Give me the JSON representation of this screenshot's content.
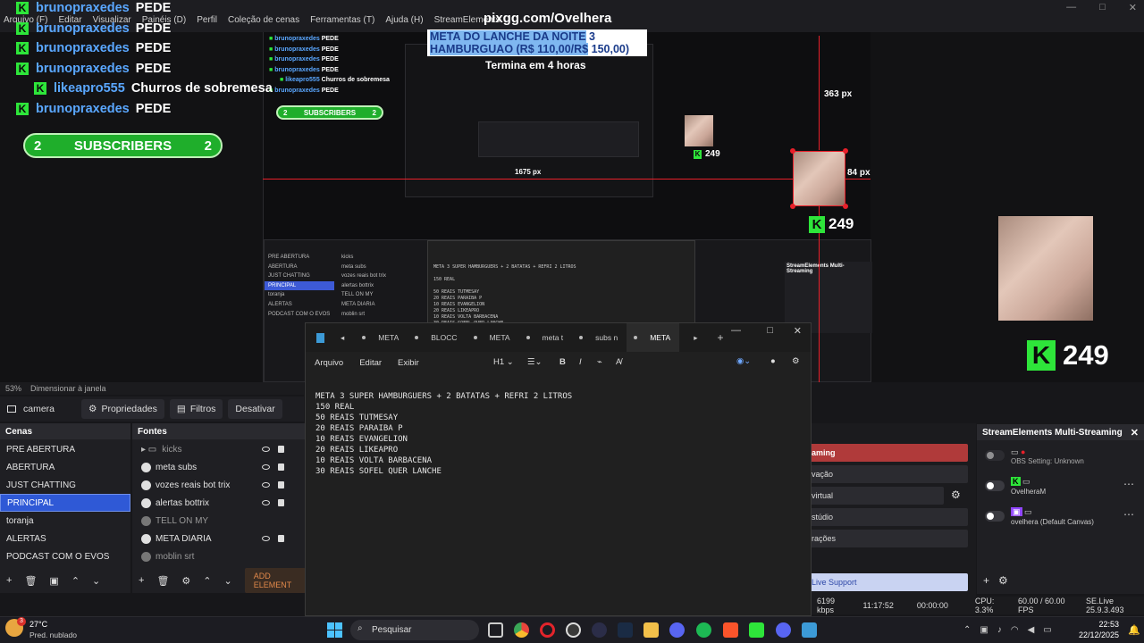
{
  "menubar": [
    "Arquivo (F)",
    "Editar",
    "Visualizar",
    "Painéis (D)",
    "Perfil",
    "Coleção de cenas",
    "Ferramentas (T)",
    "Ajuda (H)",
    "StreamElements"
  ],
  "overlay": {
    "pixgg": "pixgg.com/Ovelhera",
    "chat": [
      {
        "user": "brunopraxedes",
        "msg": "PEDE"
      },
      {
        "user": "brunopraxedes",
        "msg": "PEDE"
      },
      {
        "user": "brunopraxedes",
        "msg": "PEDE"
      },
      {
        "user": "brunopraxedes",
        "msg": "PEDE"
      },
      {
        "user": "likeapro555",
        "msg": "Churros de sobremesa"
      },
      {
        "user": "brunopraxedes",
        "msg": "PEDE"
      }
    ],
    "subs_left": "2",
    "subs_label": "SUBSCRIBERS",
    "subs_right": "2",
    "meta_line1_hl": "META DO LANCHE DA NOITE",
    "meta_line1_val": "3",
    "meta_line2_hl": "HAMBURGUAO (R$ 110,00/R$",
    "meta_line2_val": "150,00)",
    "termina": "Termina em 4 horas",
    "px_top": "363 px",
    "px_right": "84 px",
    "px_width": "1675 px",
    "kick_count": "249",
    "k_letter": "K"
  },
  "zoombar": {
    "zoom": "53%",
    "mode": "Dimensionar à janela"
  },
  "sourcebar": {
    "source_name": "camera",
    "props": "Propriedades",
    "filters": "Filtros",
    "deactivate": "Desativar"
  },
  "scenes": {
    "title": "Cenas",
    "items": [
      "PRE ABERTURA",
      "ABERTURA",
      "JUST CHATTING",
      "PRINCIPAL",
      "toranja",
      "ALERTAS",
      "PODCAST COM O EVOS"
    ],
    "active": "PRINCIPAL"
  },
  "sources": {
    "title": "Fontes",
    "items": [
      "kicks",
      "meta subs",
      "vozes reais bot trix",
      "alertas bottrix",
      "TELL ON MY",
      "META DIARIA",
      "moblin srt"
    ],
    "add": "ADD ELEMENT"
  },
  "notepad": {
    "tabs": [
      "META",
      "BLOCC",
      "META",
      "meta t",
      "subs n",
      "META"
    ],
    "menu": [
      "Arquivo",
      "Editar",
      "Exibir"
    ],
    "heading": "H1",
    "lines": [
      "META 3 SUPER HAMBURGUERS + 2 BATATAS + REFRI 2 LITROS",
      "",
      "150 REAL",
      "",
      "50 REAIS TUTMESAY",
      "20 REAIS PARAIBA P",
      "10 REAIS EVANGELION",
      "20 REAIS LIKEAPRO",
      "10 REAIS VOLTA BARBACENA",
      "30 REAIS SOFEL QUER LANCHE"
    ]
  },
  "controls": [
    "aming",
    "vação",
    "virtual",
    "stúdio",
    "rações",
    "Live Support"
  ],
  "se": {
    "title": "StreamElements Multi-Streaming",
    "rows": [
      {
        "name": "OBS Setting: Unknown",
        "sub": ""
      },
      {
        "name": "OvelheraM",
        "sub": ""
      },
      {
        "name": "ovelhera (Default Canvas)",
        "sub": ""
      }
    ]
  },
  "status": {
    "kbps": "6199 kbps",
    "rec_time": "11:17:52",
    "stream_time": "00:00:00",
    "cpu": "CPU: 3.3%",
    "fps": "60.00 / 60.00 FPS",
    "version": "SE.Live 25.9.3.493"
  },
  "taskbar": {
    "temp": "27°C",
    "weather": "Pred. nublado",
    "search": "Pesquisar",
    "time": "22:53",
    "date": "22/12/2025",
    "weather_badge": "3"
  }
}
